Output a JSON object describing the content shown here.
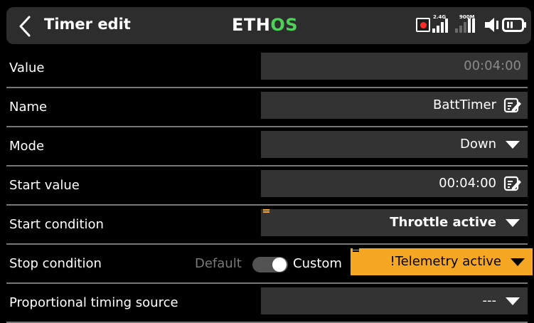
{
  "header": {
    "title": "Timer edit",
    "logo_main": "ETH",
    "logo_accent": "OS",
    "status": {
      "signal_2g4_label": "2.4G",
      "signal_900m_label": "900M"
    }
  },
  "rows": [
    {
      "label": "Value",
      "value": "00:04:00"
    },
    {
      "label": "Name",
      "value": "BattTimer"
    },
    {
      "label": "Mode",
      "value": "Down"
    },
    {
      "label": "Start value",
      "value": "00:04:00"
    },
    {
      "label": "Start condition",
      "value": "Throttle active"
    },
    {
      "label": "Stop condition",
      "toggle_left": "Default",
      "toggle_right": "Custom",
      "value": "!Telemetry active"
    },
    {
      "label": "Proportional timing source",
      "value": "---"
    }
  ],
  "colors": {
    "accent": "#f5a623",
    "logo_green": "#4fd05a",
    "field_bg": "#333333",
    "header_bg": "#2d2d2d"
  }
}
